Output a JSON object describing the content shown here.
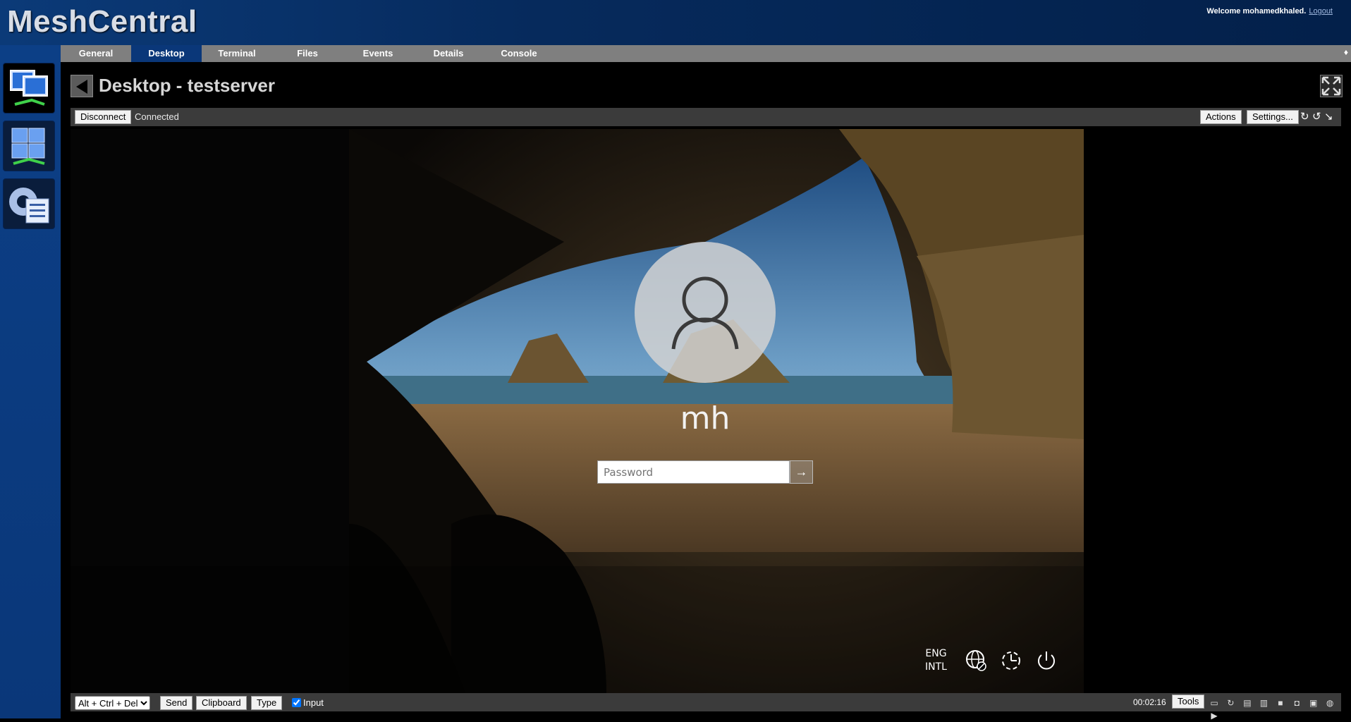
{
  "header": {
    "brand": "MeshCentral",
    "welcome": "Welcome mohamedkhaled.",
    "logout": "Logout"
  },
  "tabs": [
    {
      "label": "General"
    },
    {
      "label": "Desktop",
      "active": true
    },
    {
      "label": "Terminal"
    },
    {
      "label": "Files"
    },
    {
      "label": "Events"
    },
    {
      "label": "Details"
    },
    {
      "label": "Console"
    }
  ],
  "title": "Desktop - testserver",
  "toolbar": {
    "disconnect": "Disconnect",
    "status": "Connected",
    "actions": "Actions",
    "settings": "Settings..."
  },
  "remote": {
    "username": "mh",
    "password_placeholder": "Password",
    "lang_line1": "ENG",
    "lang_line2": "INTL"
  },
  "bottom": {
    "key_combo_selected": "Alt + Ctrl + Del",
    "send": "Send",
    "clipboard": "Clipboard",
    "type": "Type",
    "input_label": "Input",
    "input_checked": true,
    "timer": "00:02:16",
    "tools": "Tools"
  },
  "colors": {
    "header": "#062a5c",
    "active_tab": "#0a3779",
    "tabbar": "#7f7f7f",
    "toolbar": "#3b3b3b"
  }
}
